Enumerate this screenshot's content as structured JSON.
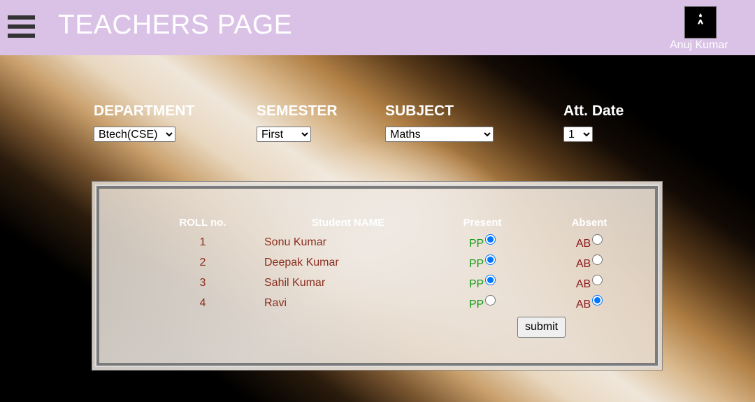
{
  "header": {
    "title": "TEACHERS PAGE",
    "user_name": "Anuj Kumar",
    "background": "#dac2e7"
  },
  "filters": {
    "department": {
      "label": "DEPARTMENT",
      "value": "Btech(CSE)"
    },
    "semester": {
      "label": "SEMESTER",
      "value": "First"
    },
    "subject": {
      "label": "SUBJECT",
      "value": "Maths"
    },
    "date": {
      "label": "Att. Date",
      "value": "1"
    }
  },
  "table": {
    "headers": {
      "roll": "ROLL no.",
      "name": "Student NAME",
      "present": "Present",
      "absent": "Absent"
    },
    "present_label": "PP",
    "absent_label": "AB",
    "rows": [
      {
        "roll": "1",
        "name": "Sonu Kumar",
        "status": "present"
      },
      {
        "roll": "2",
        "name": "Deepak Kumar",
        "status": "present"
      },
      {
        "roll": "3",
        "name": "Sahil Kumar",
        "status": "present"
      },
      {
        "roll": "4",
        "name": "Ravi",
        "status": "absent"
      }
    ]
  },
  "submit_label": "submit",
  "icons": {
    "menu": "hamburger-menu-icon",
    "avatar": "user-avatar"
  }
}
